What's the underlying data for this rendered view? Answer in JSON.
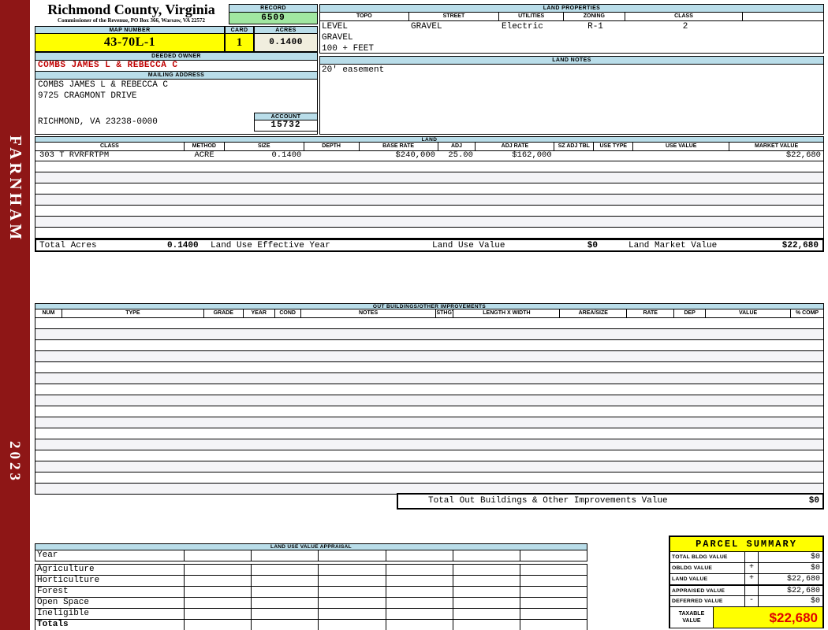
{
  "sidebar": {
    "district": "FARNHAM",
    "year": "2023"
  },
  "county": {
    "title": "Richmond County, Virginia",
    "subtitle": "Commissioner of the Revenue, PO Box 366, Warsaw, VA 22572"
  },
  "record": {
    "label": "RECORD",
    "value": "6509"
  },
  "map": {
    "label": "MAP NUMBER",
    "value": "43-70L-1"
  },
  "card": {
    "label": "CARD",
    "value": "1"
  },
  "acres": {
    "label": "ACRES",
    "value": "0.1400"
  },
  "land_properties": {
    "title": "LAND PROPERTIES",
    "columns": [
      "TOPO",
      "STREET",
      "UTILITIES",
      "ZONING",
      "CLASS"
    ],
    "topo_lines": [
      "LEVEL",
      "GRAVEL",
      "100 + FEET"
    ],
    "street": "GRAVEL",
    "utilities": "Electric",
    "zoning": "R-1",
    "class": "2"
  },
  "owner": {
    "label": "DEEDED OWNER",
    "name": "COMBS JAMES L & REBECCA C"
  },
  "mailing": {
    "label": "MAILING ADDRESS",
    "lines": [
      "COMBS JAMES L & REBECCA C",
      "9725 CRAGMONT DRIVE",
      "",
      "RICHMOND, VA 23238-0000"
    ]
  },
  "account": {
    "label": "ACCOUNT",
    "value": "15732"
  },
  "land_notes": {
    "title": "LAND NOTES",
    "text": "20' easement"
  },
  "land_table": {
    "title": "LAND",
    "columns": [
      "CLASS",
      "METHOD",
      "SIZE",
      "DEPTH",
      "BASE RATE",
      "ADJ",
      "ADJ RATE",
      "SZ ADJ TBL",
      "USE TYPE",
      "USE VALUE",
      "MARKET VALUE"
    ],
    "row_values": [
      "303 T RVRFRTPM",
      "ACRE",
      "0.1400",
      "",
      "$240,000",
      "25.00",
      "$162,000",
      "",
      "",
      "",
      "$22,680"
    ],
    "empty_row_count": 7,
    "totals": {
      "total_acres_label": "Total Acres",
      "total_acres": "0.1400",
      "effective_year_label": "Land Use Effective Year",
      "use_value_label": "Land Use Value",
      "use_value": "$0",
      "market_value_label": "Land Market Value",
      "market_value": "$22,680"
    }
  },
  "out_buildings": {
    "title": "OUT BUILDINGS/OTHER IMPROVEMENTS",
    "columns": [
      "NUM",
      "TYPE",
      "GRADE",
      "YEAR",
      "COND",
      "NOTES",
      "STHGT",
      "LENGTH X WIDTH",
      "AREA/SIZE",
      "RATE",
      "DEP",
      "VALUE",
      "% COMP"
    ],
    "empty_row_count": 16,
    "total_label": "Total Out Buildings & Other Improvements Value",
    "total_value": "$0"
  },
  "land_use_appraisal": {
    "title": "LAND USE VALUE APPRAISAL",
    "row_labels": [
      "Year",
      "Agriculture",
      "Horticulture",
      "Forest",
      "Open Space",
      "Ineligible",
      "Totals"
    ],
    "column_count": 6
  },
  "parcel_summary": {
    "title": "PARCEL SUMMARY",
    "rows": [
      {
        "label": "TOTAL BLDG VALUE",
        "op": "",
        "value": "$0"
      },
      {
        "label": "OBLDG VALUE",
        "op": "+",
        "value": "$0"
      },
      {
        "label": "LAND VALUE",
        "op": "+",
        "value": "$22,680"
      },
      {
        "label": "APPRAISED VALUE",
        "op": "",
        "value": "$22,680"
      },
      {
        "label": "DEFERRED VALUE",
        "op": "-",
        "value": "$0"
      }
    ],
    "taxable": {
      "label": "TAXABLE VALUE",
      "value": "$22,680"
    }
  },
  "colors": {
    "maroon": "#8E1616",
    "header_blue": "#B9DDE9",
    "record_green": "#A1E7A1",
    "yellow": "#FFFF00",
    "cream": "#F0EEDE",
    "owner_red": "#C00000",
    "taxable_red": "#E00000"
  }
}
